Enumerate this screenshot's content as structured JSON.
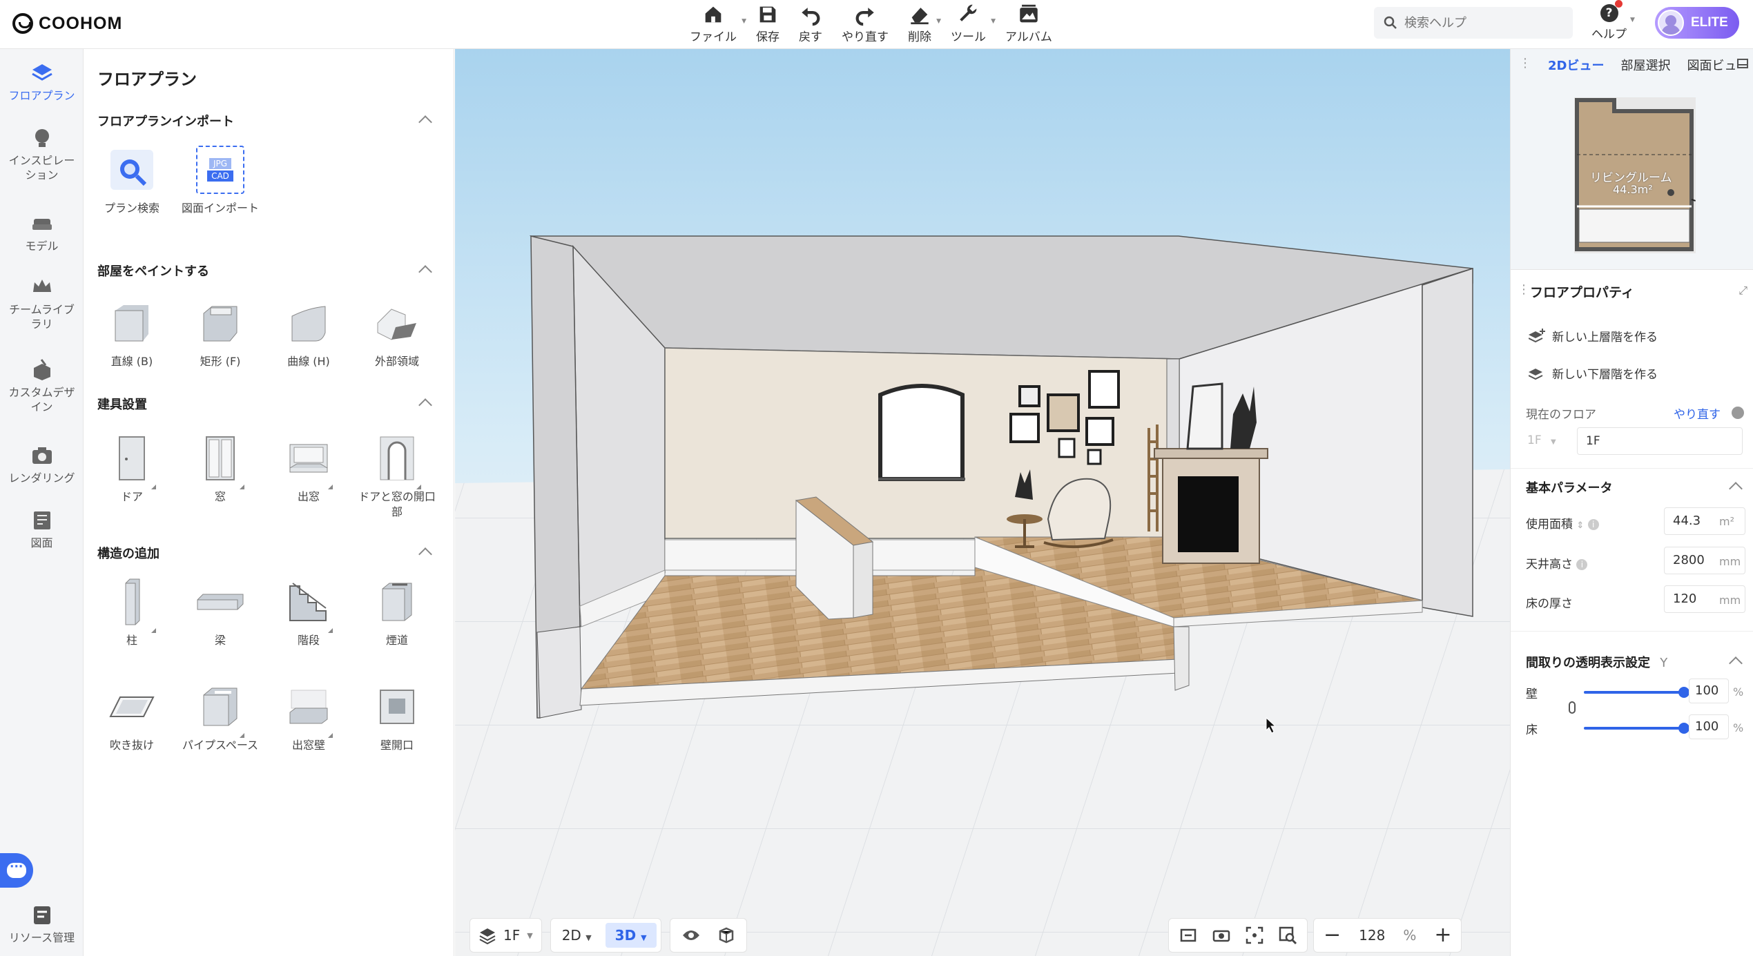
{
  "app": {
    "logo": "COOHOM"
  },
  "toolbar": {
    "file": "ファイル",
    "save": "保存",
    "undo": "戻す",
    "redo": "やり直す",
    "delete": "削除",
    "tools": "ツール",
    "album": "アルバム"
  },
  "search": {
    "placeholder": "検索ヘルプ"
  },
  "help": {
    "label": "ヘルプ"
  },
  "account": {
    "badge": "ELITE"
  },
  "rail": {
    "items": [
      {
        "label": "フロアプラン"
      },
      {
        "label": "インスピレーション"
      },
      {
        "label": "モデル"
      },
      {
        "label": "チームライブラリ"
      },
      {
        "label": "カスタムデザイン"
      },
      {
        "label": "レンダリング"
      },
      {
        "label": "図面"
      }
    ],
    "resources": "リソース管理"
  },
  "panel": {
    "title": "フロアプラン",
    "sections": {
      "import": {
        "title": "フロアプランインポート",
        "items": [
          "プラン検索",
          "図面インポート"
        ]
      },
      "paint": {
        "title": "部屋をペイントする",
        "items": [
          "直線 (B)",
          "矩形 (F)",
          "曲線 (H)",
          "外部領域"
        ]
      },
      "fixtures": {
        "title": "建具設置",
        "items": [
          "ドア",
          "窓",
          "出窓",
          "ドアと窓の開口部"
        ]
      },
      "structure": {
        "title": "構造の追加",
        "items": [
          "柱",
          "梁",
          "階段",
          "煙道",
          "吹き抜け",
          "パイプスペース",
          "出窓壁",
          "壁開口"
        ]
      }
    },
    "import_icon_text": {
      "jpg": "JPG",
      "cad": "CAD"
    }
  },
  "viewport": {
    "floor": "1F",
    "mode2d": "2D",
    "mode3d": "3D",
    "zoom": "128",
    "zoom_unit": "%"
  },
  "right": {
    "tabs": [
      "2Dビュー",
      "部屋選択",
      "図面ビュー"
    ],
    "minimap": {
      "room_name": "リビングルーム",
      "room_area": "44.3m²"
    },
    "props_title": "フロアプロパティ",
    "add_upper": "新しい上層階を作る",
    "add_lower": "新しい下層階を作る",
    "current_floor_label": "現在のフロア",
    "redo_link": "やり直す",
    "floor_select": "1F",
    "floor_name": "1F",
    "basic_params": "基本パラメータ",
    "area_label": "使用面積",
    "area_value": "44.3",
    "area_unit": "m²",
    "ceiling_label": "天井高さ",
    "ceiling_value": "2800",
    "ceiling_unit": "mm",
    "floor_thick_label": "床の厚さ",
    "floor_thick_value": "120",
    "floor_thick_unit": "mm",
    "transparency_title": "間取りの透明表示設定",
    "transparency_key": "Y",
    "wall_label": "壁",
    "wall_value": "100",
    "floor_label": "床",
    "floor_value": "100",
    "pct": "%"
  },
  "colors": {
    "accent": "#2f64e8",
    "elite_start": "#b59bff",
    "elite_end": "#7b5cf0",
    "notify": "#e53935"
  }
}
